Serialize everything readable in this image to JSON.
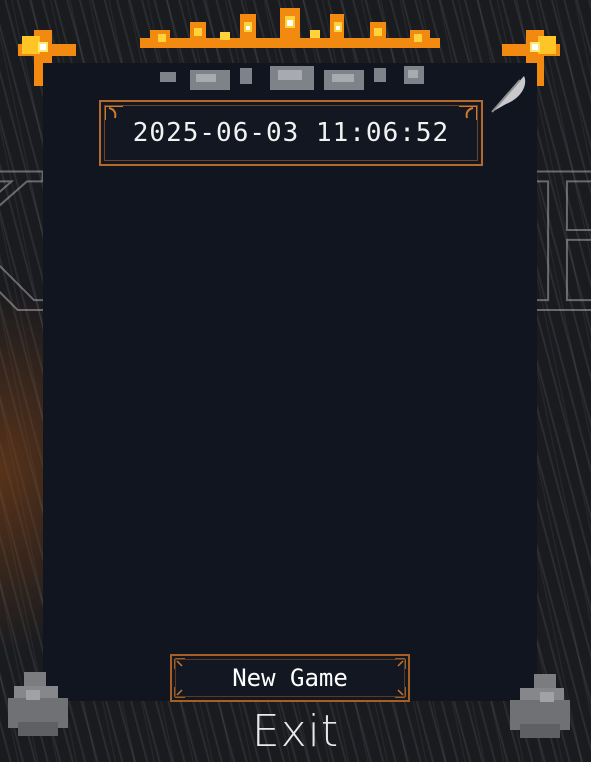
{
  "save_slot": {
    "timestamp": "2025-06-03 11:06:52"
  },
  "menu": {
    "new_game_label": "New Game",
    "exit_label": "Exit"
  },
  "background": {
    "left_letter": "K",
    "right_letter": "B"
  },
  "colors": {
    "frame_orange": "#b46a2c",
    "panel": "#111520",
    "flame": "#f6a81a"
  },
  "icons": [
    "flame-crown-icon",
    "torch-corner-icon",
    "chain-icon",
    "feather-icon",
    "stone-icon"
  ]
}
